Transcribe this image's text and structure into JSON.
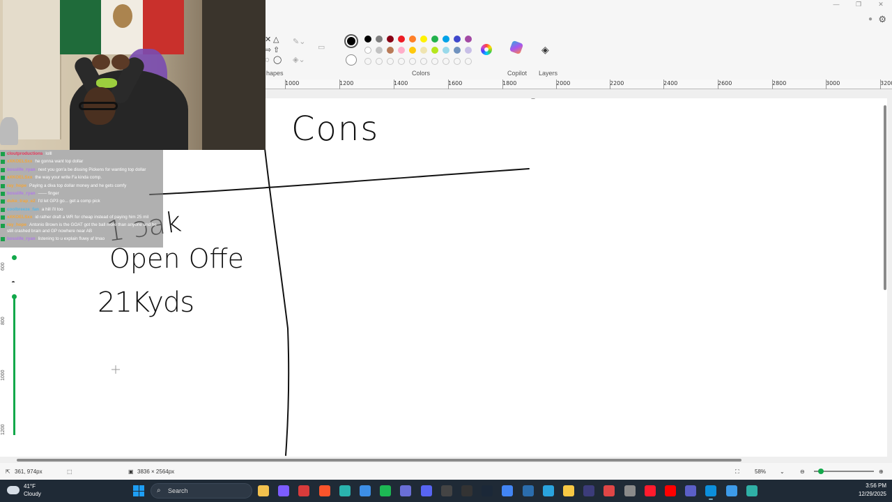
{
  "window": {
    "minimize": "—",
    "restore": "❐",
    "close": "✕"
  },
  "toolbar": {
    "shapes_label": "hapes",
    "colors_label": "Colors",
    "copilot_label": "Copilot",
    "layers_label": "Layers",
    "primary_color": "#000000",
    "secondary_color": "#ffffff",
    "palette": [
      "#000000",
      "#7f7f7f",
      "#880015",
      "#ed1c24",
      "#ff7f27",
      "#fff200",
      "#22b14c",
      "#00a2e8",
      "#3f48cc",
      "#a349a4",
      "#ffffff",
      "#c3c3c3",
      "#b97a57",
      "#ffaec9",
      "#ffc90e",
      "#efe4b0",
      "#b5e61d",
      "#99d9ea",
      "#7092be",
      "#c8bfe7"
    ]
  },
  "ruler": {
    "ticks": [
      "1000",
      "1200",
      "1400",
      "1600",
      "1800",
      "2000",
      "2200",
      "2400",
      "2600",
      "2800",
      "3000",
      "3200"
    ]
  },
  "vertical_ruler": {
    "labels": [
      "600",
      "800",
      "1000",
      "1200"
    ]
  },
  "canvas": {
    "handwriting": [
      "Cons",
      "1 ɔak",
      "Open Offe",
      "21Kyds"
    ]
  },
  "chat": {
    "messages": [
      {
        "user": "cloutproductions",
        "user_color": "#e8365a",
        "text": "lolll",
        "wrap": false
      },
      {
        "user": "xXKOELSxx",
        "user_color": "#f3a63a",
        "text": "he gonna want top dollar",
        "wrap": false
      },
      {
        "user": "bosslife_ryan",
        "user_color": "#b07ae8",
        "text": "next you gon'a be dissing Pickens for wanting top dollar",
        "wrap": false
      },
      {
        "user": "xXKOELSxx",
        "user_color": "#f3a63a",
        "text": "the way your write Fa kinda comp.",
        "wrap": false
      },
      {
        "user": "ray_hope",
        "user_color": "#f3a63a",
        "text": "Paying a diva top dollar money and he gets comfy",
        "wrap": false
      },
      {
        "user": "bosslife_ryan",
        "user_color": "#b07ae8",
        "text": "—— finger",
        "wrap": false
      },
      {
        "user": "duke_trap_e2",
        "user_color": "#f3a63a",
        "text": "I'd let GP3 go... get a comp pick",
        "wrap": false
      },
      {
        "user": "coolbreeze_fan",
        "user_color": "#56b6e8",
        "text": "a hill i'll too",
        "wrap": false
      },
      {
        "user": "xXKOELSxx",
        "user_color": "#f3a63a",
        "text": "id rather draft a WR for cheap instead of paying him 25 mil",
        "wrap": false
      },
      {
        "user": "ray_hope",
        "user_color": "#f3a63a",
        "text": "Antonio Brown is the GOAT got the ball more than anyone and he still crashed brain and GP nowhere near AB",
        "wrap": true
      },
      {
        "user": "bosslife_ryan",
        "user_color": "#b07ae8",
        "text": "listening to u explain fluwy af lmao",
        "wrap": false
      }
    ]
  },
  "statusbar": {
    "cursor_pos": "361, 974px",
    "canvas_size": "3836 × 2564px",
    "zoom": "58%"
  },
  "taskbar": {
    "weather_temp": "41°F",
    "weather_cond": "Cloudy",
    "search_placeholder": "Search",
    "time": "3:56 PM",
    "date": "12/29/2025",
    "apps": [
      {
        "name": "file-explorer-app",
        "color": "#f2c14e"
      },
      {
        "name": "copilot-app",
        "color": "#7c5cff"
      },
      {
        "name": "news-app",
        "color": "#d83b3b"
      },
      {
        "name": "brave-app",
        "color": "#fb542b"
      },
      {
        "name": "edge-app",
        "color": "#2ab3ae"
      },
      {
        "name": "photos-app",
        "color": "#3d8ee6"
      },
      {
        "name": "spotify-app",
        "color": "#1db954"
      },
      {
        "name": "app-9",
        "color": "#6a6fd6"
      },
      {
        "name": "discord-app",
        "color": "#5865f2"
      },
      {
        "name": "obs-app",
        "color": "#444"
      },
      {
        "name": "threads-app",
        "color": "#333"
      },
      {
        "name": "steam-app",
        "color": "#1b2838"
      },
      {
        "name": "chrome-app",
        "color": "#4285f4"
      },
      {
        "name": "app-14",
        "color": "#2b6dad"
      },
      {
        "name": "telegram-app",
        "color": "#2aa3de"
      },
      {
        "name": "folder-app",
        "color": "#f7c844"
      },
      {
        "name": "media-app",
        "color": "#3c3c7a"
      },
      {
        "name": "app-18",
        "color": "#e04646"
      },
      {
        "name": "app-19",
        "color": "#8a8a8a"
      },
      {
        "name": "opera-app",
        "color": "#ff1b2d"
      },
      {
        "name": "youtube-app",
        "color": "#ff0000"
      },
      {
        "name": "teams-app",
        "color": "#5b5fc7"
      },
      {
        "name": "edge-active-app",
        "color": "#0c8fdc"
      },
      {
        "name": "notepad-app",
        "color": "#3d9be9"
      },
      {
        "name": "paint-app",
        "color": "#2fb0a6"
      }
    ]
  }
}
